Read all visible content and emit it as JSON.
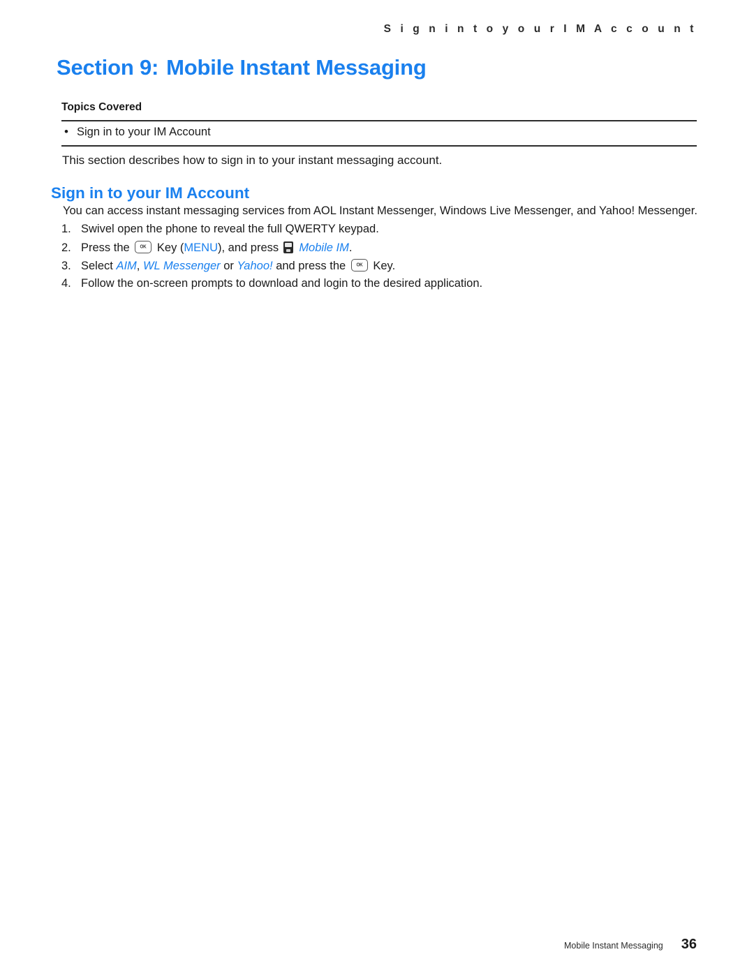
{
  "running_header": "S i g n   i n   t o   y o u r   I M   A c c o u n t",
  "section": {
    "number_label": "Section 9:",
    "title": "Mobile Instant Messaging"
  },
  "topics": {
    "label": "Topics Covered",
    "bullet": "•",
    "items": [
      "Sign in to your IM Account"
    ]
  },
  "intro": "This section describes how to sign in to your instant messaging account.",
  "subsection": {
    "heading": "Sign in to your IM Account",
    "lead": "You can access instant messaging services from AOL Instant Messenger, Windows Live Messenger, and Yahoo! Messenger."
  },
  "steps": [
    {
      "number": "1.",
      "parts": [
        {
          "type": "text",
          "value": "Swivel open the phone to reveal the full QWERTY keypad."
        }
      ]
    },
    {
      "number": "2.",
      "parts": [
        {
          "type": "text",
          "value": "Press the"
        },
        {
          "type": "ok-key",
          "value": "OK"
        },
        {
          "type": "text",
          "value": "Key ("
        },
        {
          "type": "blue",
          "value": "MENU"
        },
        {
          "type": "text",
          "value": "), and press"
        },
        {
          "type": "device-icon",
          "value": "mobile-im-icon"
        },
        {
          "type": "blue-italic",
          "value": "Mobile IM"
        },
        {
          "type": "text",
          "value": "."
        }
      ]
    },
    {
      "number": "3.",
      "parts": [
        {
          "type": "text",
          "value": "Select"
        },
        {
          "type": "blue-italic",
          "value": "AIM"
        },
        {
          "type": "text",
          "value": ","
        },
        {
          "type": "blue-italic",
          "value": "WL Messenger"
        },
        {
          "type": "text",
          "value": "or"
        },
        {
          "type": "blue-italic",
          "value": "Yahoo!"
        },
        {
          "type": "text",
          "value": "and press the"
        },
        {
          "type": "ok-key",
          "value": "OK"
        },
        {
          "type": "text",
          "value": "Key."
        }
      ]
    },
    {
      "number": "4.",
      "parts": [
        {
          "type": "text",
          "value": "Follow the on-screen prompts to download and login to the desired application."
        }
      ]
    }
  ],
  "footer": {
    "text": "Mobile Instant Messaging",
    "page_number": "36"
  },
  "colors": {
    "accent_blue": "#1a80ee",
    "body_text": "#1a1a1a",
    "rule": "#2c2c2c"
  }
}
